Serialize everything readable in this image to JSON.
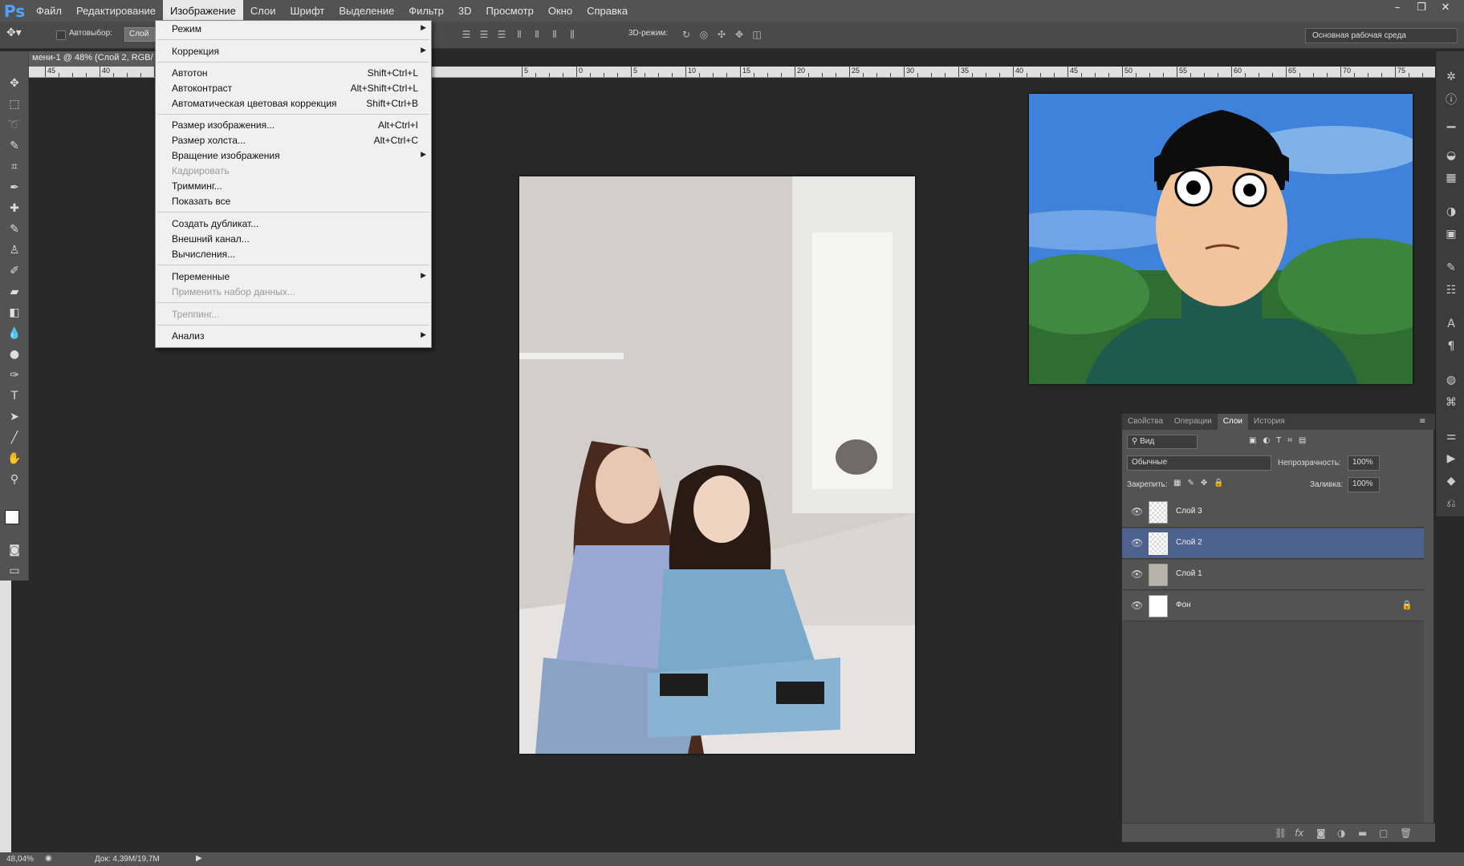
{
  "app": {
    "logo": "Ps"
  },
  "menubar": {
    "items": [
      "Файл",
      "Редактирование",
      "Изображение",
      "Слои",
      "Шрифт",
      "Выделение",
      "Фильтр",
      "3D",
      "Просмотр",
      "Окно",
      "Справка"
    ],
    "active": "Изображение"
  },
  "window_controls": {
    "minimize": "–",
    "restore": "❐",
    "close": "✕"
  },
  "options_bar": {
    "autoselect_label": "Автовыбор:",
    "layer_value": "Слой",
    "mode3d_label": "3D-режим:",
    "workspace": "Основная рабочая среда"
  },
  "document": {
    "tab_title": "мени-1 @ 48% (Слой 2, RGB/"
  },
  "ruler": {
    "labels": [
      "45",
      "40",
      "35",
      "5",
      "0",
      "5",
      "10",
      "15",
      "20",
      "25",
      "30",
      "35",
      "40",
      "45",
      "50",
      "55",
      "60",
      "65",
      "70",
      "75",
      "80"
    ]
  },
  "image_menu": {
    "items": [
      {
        "label": "Режим",
        "submenu": true
      },
      {
        "label": "Коррекция",
        "submenu": true
      },
      {
        "label": "Автотон",
        "shortcut": "Shift+Ctrl+L"
      },
      {
        "label": "Автоконтраст",
        "shortcut": "Alt+Shift+Ctrl+L"
      },
      {
        "label": "Автоматическая цветовая коррекция",
        "shortcut": "Shift+Ctrl+B"
      },
      {
        "label": "Размер изображения...",
        "shortcut": "Alt+Ctrl+I"
      },
      {
        "label": "Размер холста...",
        "shortcut": "Alt+Ctrl+C"
      },
      {
        "label": "Вращение изображения",
        "submenu": true
      },
      {
        "label": "Кадрировать",
        "disabled": true
      },
      {
        "label": "Тримминг..."
      },
      {
        "label": "Показать все"
      },
      {
        "label": "Создать дубликат..."
      },
      {
        "label": "Внешний канал..."
      },
      {
        "label": "Вычисления..."
      },
      {
        "label": "Переменные",
        "submenu": true
      },
      {
        "label": "Применить набор данных...",
        "disabled": true
      },
      {
        "label": "Треппинг...",
        "disabled": true
      },
      {
        "label": "Анализ",
        "submenu": true
      }
    ]
  },
  "layers_panel": {
    "tabs": [
      "Свойства",
      "Операции",
      "Слои",
      "История"
    ],
    "active_tab": "Слои",
    "filter_label": "Вид",
    "blend_mode": "Обычные",
    "opacity_label": "Непрозрачность:",
    "opacity_value": "100%",
    "lock_label": "Закрепить:",
    "fill_label": "Заливка:",
    "fill_value": "100%",
    "layers": [
      {
        "name": "Слой 3",
        "selected": false,
        "locked": false
      },
      {
        "name": "Слой 2",
        "selected": true,
        "locked": false
      },
      {
        "name": "Слой 1",
        "selected": false,
        "locked": false
      },
      {
        "name": "Фон",
        "selected": false,
        "locked": true
      }
    ]
  },
  "statusbar": {
    "zoom": "48,04%",
    "doc": "Док: 4,39M/19,7M"
  },
  "colors": {
    "menubar": "#535353",
    "canvas": "#282828",
    "selected_layer": "#4e6290",
    "menu_bg": "#f0f0f0"
  }
}
